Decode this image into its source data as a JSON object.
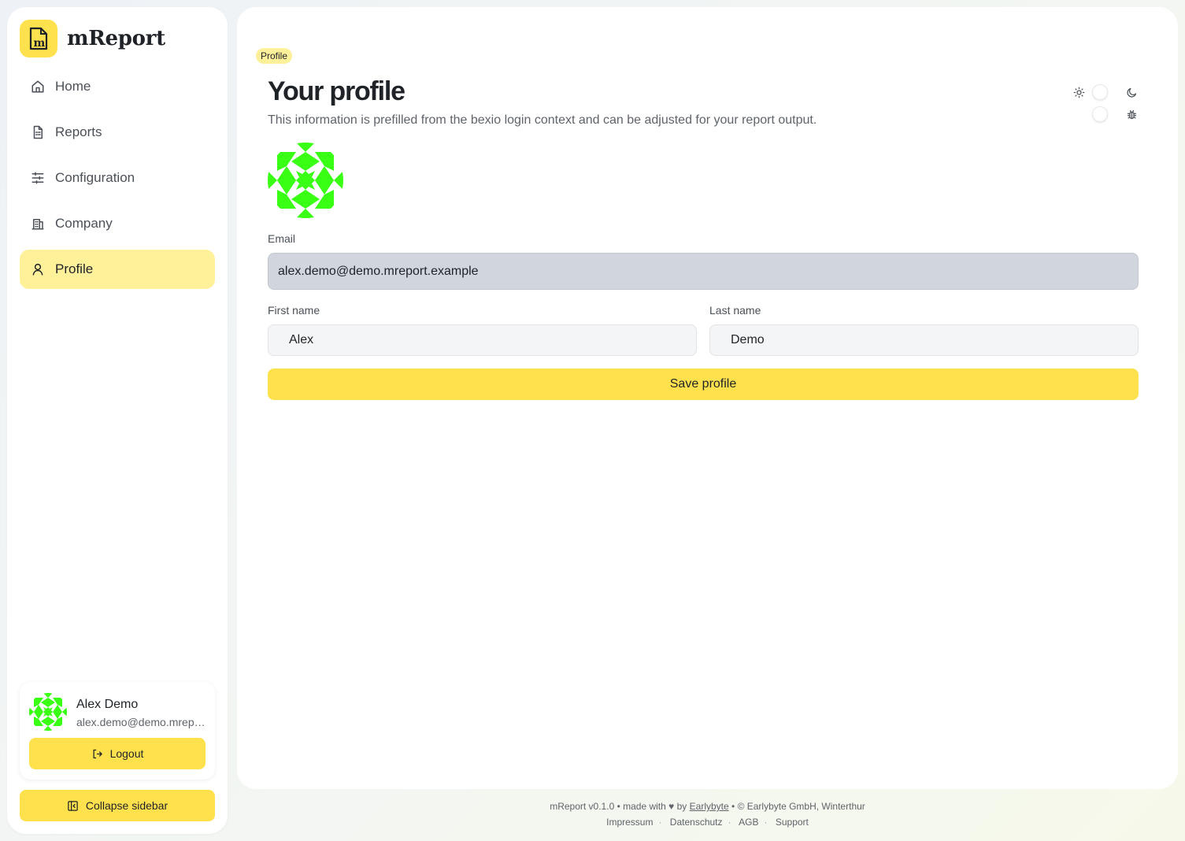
{
  "app": {
    "name": "mReport",
    "logo_letter": "m",
    "accent_color": "#ffe14d",
    "active_nav_color": "#fff09a",
    "avatar_color": "#39ff14"
  },
  "sidebar": {
    "items": [
      {
        "label": "Home",
        "icon": "home-icon",
        "active": false
      },
      {
        "label": "Reports",
        "icon": "document-icon",
        "active": false
      },
      {
        "label": "Configuration",
        "icon": "sliders-icon",
        "active": false
      },
      {
        "label": "Company",
        "icon": "building-icon",
        "active": false
      },
      {
        "label": "Profile",
        "icon": "user-icon",
        "active": true
      }
    ],
    "user": {
      "name": "Alex Demo",
      "email": "alex.demo@demo.mreport.example"
    },
    "logout_label": "Logout",
    "collapse_label": "Collapse sidebar"
  },
  "main": {
    "breadcrumb": "Profile",
    "title": "Your profile",
    "subtitle": "This information is prefilled from the bexio login context and can be adjusted for your report output.",
    "form": {
      "email_label": "Email",
      "email_value": "alex.demo@demo.mreport.example",
      "first_name_label": "First name",
      "first_name_value": "Alex",
      "last_name_label": "Last name",
      "last_name_value": "Demo",
      "save_label": "Save profile"
    },
    "toggles": [
      {
        "icon": "sun-icon",
        "alt_icon": "moon-icon"
      },
      {
        "icon": "bug-icon"
      }
    ]
  },
  "footer": {
    "version_text": "mReport v0.1.0 • made with",
    "by_text": "by",
    "author_link": "Earlybyte",
    "copyright": "• © Earlybyte GmbH, Winterthur",
    "links": [
      "Impressum",
      "Datenschutz",
      "AGB",
      "Support"
    ]
  }
}
